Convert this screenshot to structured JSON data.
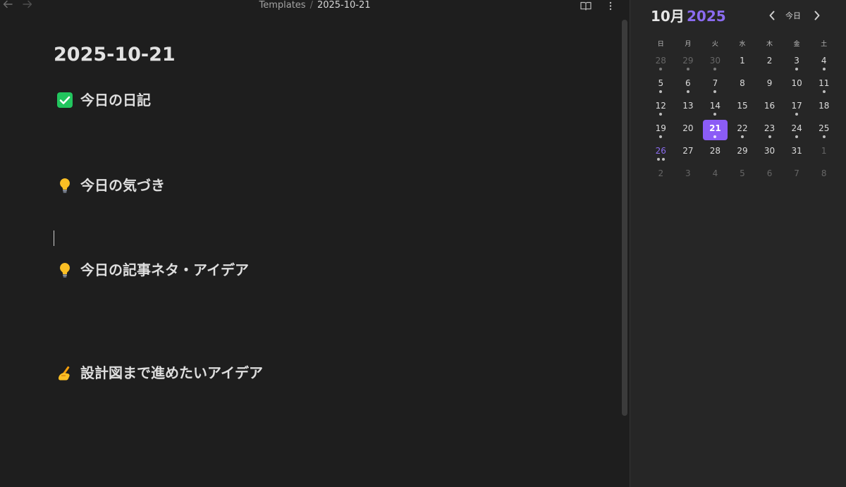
{
  "breadcrumb": {
    "parent": "Templates",
    "separator": "/",
    "current": "2025-10-21"
  },
  "note": {
    "title": "2025-10-21",
    "headings": [
      {
        "icon": "check-box-icon",
        "text": "今日の日記"
      },
      {
        "icon": "light-bulb-icon",
        "text": "今日の気づき"
      },
      {
        "icon": "light-bulb-icon",
        "text": "今日の記事ネタ・アイデア"
      },
      {
        "icon": "writing-hand-icon",
        "text": "設計図まで進めたいアイデア"
      }
    ]
  },
  "calendar": {
    "month": "10月",
    "year": "2025",
    "today_label": "今日",
    "weekdays": [
      "日",
      "月",
      "火",
      "水",
      "木",
      "金",
      "土"
    ],
    "days": [
      {
        "n": "28",
        "muted": true,
        "dots": 1
      },
      {
        "n": "29",
        "muted": true,
        "dots": 1
      },
      {
        "n": "30",
        "muted": true,
        "dots": 1
      },
      {
        "n": "1",
        "dots": 0
      },
      {
        "n": "2",
        "dots": 0
      },
      {
        "n": "3",
        "dots": 1
      },
      {
        "n": "4",
        "dots": 1
      },
      {
        "n": "5",
        "dots": 1
      },
      {
        "n": "6",
        "dots": 1
      },
      {
        "n": "7",
        "dots": 1
      },
      {
        "n": "8",
        "dots": 0
      },
      {
        "n": "9",
        "dots": 0
      },
      {
        "n": "10",
        "dots": 0
      },
      {
        "n": "11",
        "dots": 1
      },
      {
        "n": "12",
        "dots": 1
      },
      {
        "n": "13",
        "dots": 0
      },
      {
        "n": "14",
        "dots": 1
      },
      {
        "n": "15",
        "dots": 0
      },
      {
        "n": "16",
        "dots": 0
      },
      {
        "n": "17",
        "dots": 1
      },
      {
        "n": "18",
        "dots": 0
      },
      {
        "n": "19",
        "dots": 1
      },
      {
        "n": "20",
        "dots": 0
      },
      {
        "n": "21",
        "dots": 1,
        "selected": true
      },
      {
        "n": "22",
        "dots": 1
      },
      {
        "n": "23",
        "dots": 1
      },
      {
        "n": "24",
        "dots": 1
      },
      {
        "n": "25",
        "dots": 1
      },
      {
        "n": "26",
        "dots": 2,
        "accent": true
      },
      {
        "n": "27",
        "dots": 0
      },
      {
        "n": "28",
        "dots": 0
      },
      {
        "n": "29",
        "dots": 0
      },
      {
        "n": "30",
        "dots": 0
      },
      {
        "n": "31",
        "dots": 0
      },
      {
        "n": "1",
        "muted": true,
        "dots": 0
      },
      {
        "n": "2",
        "muted": true,
        "dots": 0
      },
      {
        "n": "3",
        "muted": true,
        "dots": 0
      },
      {
        "n": "4",
        "muted": true,
        "dots": 0
      },
      {
        "n": "5",
        "muted": true,
        "dots": 0
      },
      {
        "n": "6",
        "muted": true,
        "dots": 0
      },
      {
        "n": "7",
        "muted": true,
        "dots": 0
      },
      {
        "n": "8",
        "muted": true,
        "dots": 0
      }
    ]
  },
  "colors": {
    "accent": "#8b5cf6",
    "year": "#8b6cf0",
    "editor_bg": "#1e1e1e",
    "sidebar_bg": "#262626",
    "check_green": "#22c55e"
  }
}
